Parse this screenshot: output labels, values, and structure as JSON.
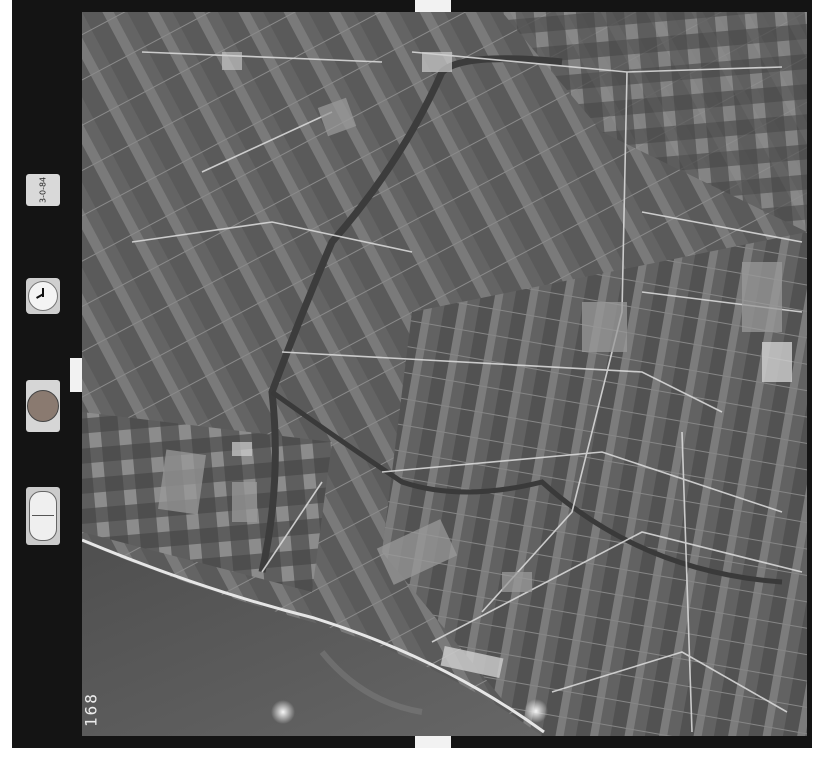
{
  "photo": {
    "frame_number": "168",
    "date_stamp": "3-0-84",
    "altimeter_text": "",
    "colors": {
      "sea": "#5c5c5c",
      "land": "#6e6e6e",
      "film_border": "#141414",
      "roads": "#d8d8d8"
    }
  }
}
